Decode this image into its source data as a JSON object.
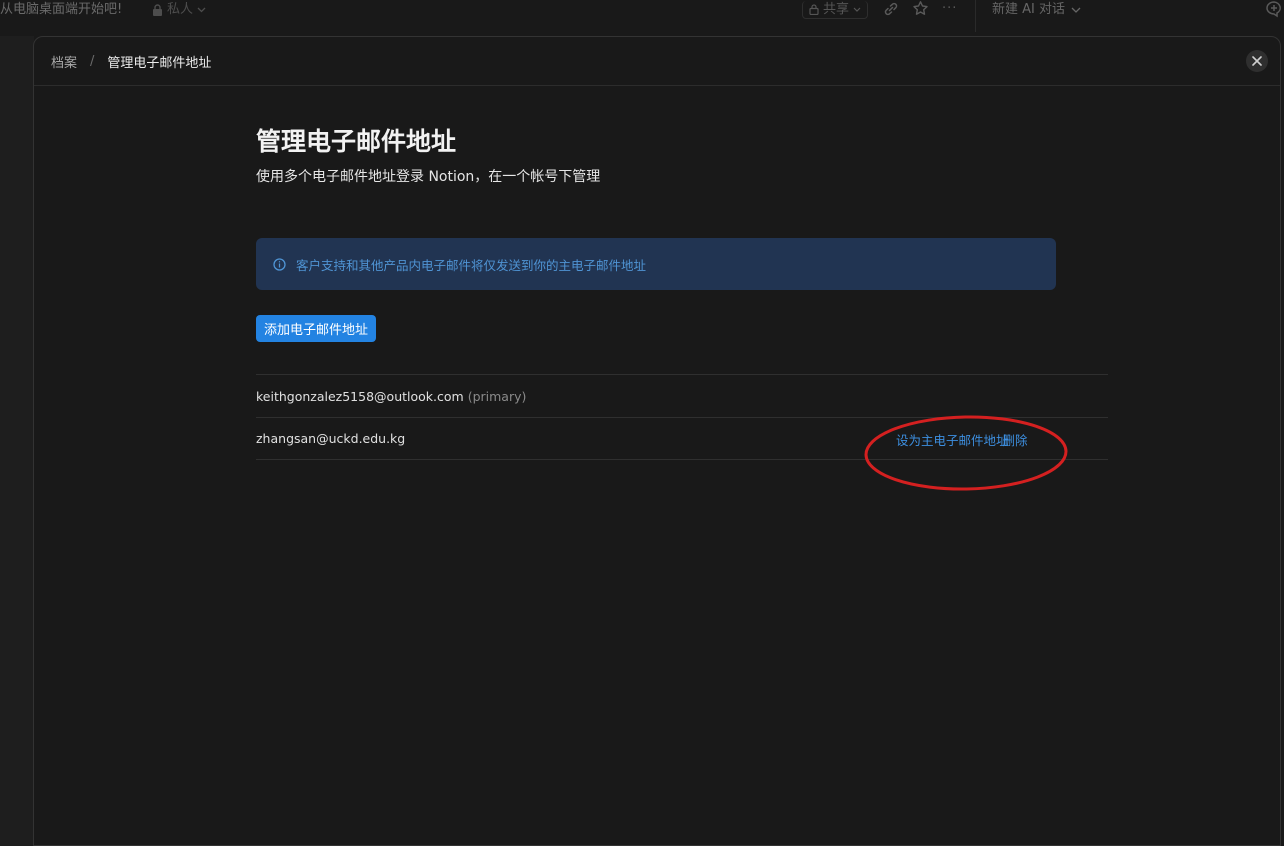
{
  "topbar": {
    "page_title": "从电脑桌面端开始吧!",
    "privacy_label": "私人",
    "share_label": "共享",
    "new_ai_chat_label": "新建 AI 对话",
    "more_icon": "···"
  },
  "modal": {
    "breadcrumb": {
      "parent": "档案",
      "separator": "/",
      "current": "管理电子邮件地址"
    },
    "close_icon": "×"
  },
  "page": {
    "heading": "管理电子邮件地址",
    "subtitle": "使用多个电子邮件地址登录 Notion，在一个帐号下管理",
    "info_text": "客户支持和其他产品内电子邮件将仅发送到你的主电子邮件地址",
    "add_button_label": "添加电子邮件地址"
  },
  "emails": [
    {
      "address": "keithgonzalez5158@outlook.com",
      "tag": "(primary)"
    },
    {
      "address": "zhangsan@uckd.edu.kg",
      "set_primary_label": "设为主电子邮件地址",
      "remove_label": "删除"
    }
  ],
  "colors": {
    "background": "#191919",
    "accent": "#2383e2",
    "link": "#3d8fe0",
    "info_bg": "#213452",
    "annotation": "#d42020"
  }
}
